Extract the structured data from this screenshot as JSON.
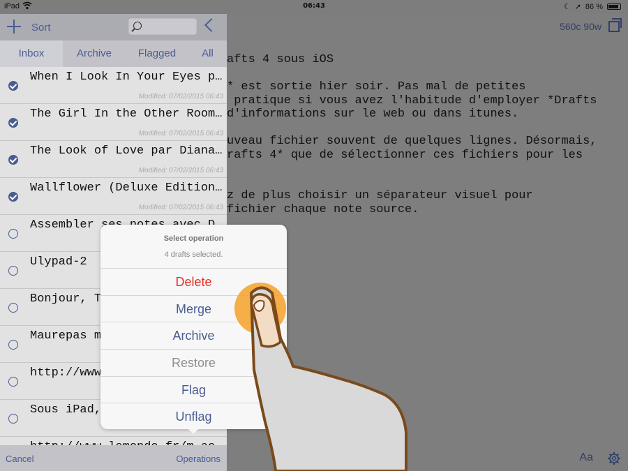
{
  "status": {
    "device": "iPad",
    "time": "06:43",
    "battery": "86 %"
  },
  "sidebar": {
    "sort_label": "Sort",
    "tabs": [
      {
        "label": "Inbox",
        "active": true
      },
      {
        "label": "Archive",
        "active": false
      },
      {
        "label": "Flagged",
        "active": false
      },
      {
        "label": "All",
        "active": false
      }
    ],
    "drafts": [
      {
        "title": "When I Look In Your Eyes p…",
        "meta": "Modified: 07/02/2015 06:43",
        "checked": true
      },
      {
        "title": "The Girl In the Other Room…",
        "meta": "Modified: 07/02/2015 06:43",
        "checked": true
      },
      {
        "title": "The Look of Love par Diana…",
        "meta": "Modified: 07/02/2015 06:43",
        "checked": true
      },
      {
        "title": "Wallflower (Deluxe Edition…",
        "meta": "Modified: 07/02/2015 06:43",
        "checked": true
      },
      {
        "title": "Assembler ses notes avec D…",
        "meta": "",
        "checked": false
      },
      {
        "title": "Ulypad-2",
        "meta": "",
        "checked": false
      },
      {
        "title": "Bonjour, T",
        "meta": "",
        "checked": false
      },
      {
        "title": "Maurepas m",
        "meta": "",
        "checked": false
      },
      {
        "title": "http://www",
        "meta": "",
        "checked": false
      },
      {
        "title": "Sous iPad,",
        "meta": "",
        "checked": false
      },
      {
        "title": "http://www.lemonde.fr/m-ac",
        "meta": "",
        "checked": false
      }
    ],
    "footer": {
      "cancel": "Cancel",
      "operations": "Operations"
    }
  },
  "editor": {
    "counter": "560c 90w",
    "lines": [
      "afts 4 sous iOS",
      "",
      "* est sortie hier soir. Pas mal de petites",
      " pratique si vous avez l'habitude d'employer *Drafts",
      "d'informations sur le web ou dans itunes.",
      "",
      "uveau fichier souvent de quelques lignes. Désormais,",
      "rafts 4* que de sélectionner ces fichiers pour les",
      "",
      "",
      "z de plus choisir un séparateur visuel pour",
      "fichier chaque note source."
    ],
    "font_button": "Aa"
  },
  "action_sheet": {
    "title": "Select operation",
    "message": "4 drafts selected.",
    "buttons": [
      {
        "label": "Delete",
        "color": "#e5302a"
      },
      {
        "label": "Merge",
        "color": "#4a5d92"
      },
      {
        "label": "Archive",
        "color": "#4a5d92"
      },
      {
        "label": "Restore",
        "color": "#8e8e8e"
      },
      {
        "label": "Flag",
        "color": "#4a5d92"
      },
      {
        "label": "Unflag",
        "color": "#4a5d92"
      }
    ]
  },
  "colors": {
    "accent": "#4a5d92",
    "destructive": "#e5302a",
    "touch": "#f4a534"
  }
}
